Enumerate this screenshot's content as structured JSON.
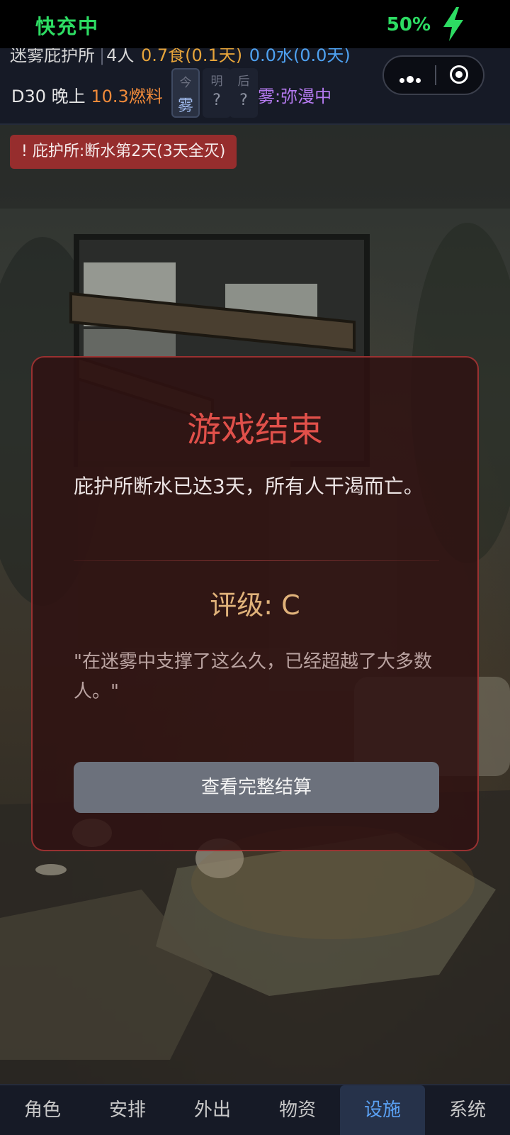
{
  "status_bar": {
    "left_text": "快充中",
    "battery": "50%"
  },
  "header": {
    "resource_row": {
      "shelter": "迷雾庇护所",
      "people": "4人",
      "food": "0.7食(0.1天)",
      "water": "0.0水(0.0天)"
    },
    "day": "D30",
    "period": "晚上",
    "fuel": "10.3燃料",
    "forecast": [
      {
        "label": "今",
        "value": "雾"
      },
      {
        "label": "明",
        "value": "?"
      },
      {
        "label": "后",
        "value": "?"
      }
    ],
    "fog_status": "雾:弥漫中"
  },
  "alert": {
    "text": "! 庇护所:断水第2天(3天全灭)"
  },
  "modal": {
    "title": "游戏结束",
    "message": "庇护所断水已达3天，所有人干渴而亡。",
    "rating": "评级: C",
    "quote": "\"在迷雾中支撑了这么久，已经超越了大多数人。\"",
    "button": "查看完整结算"
  },
  "bottom_nav": {
    "items": [
      "角色",
      "安排",
      "外出",
      "物资",
      "设施",
      "系统"
    ],
    "active": "设施"
  },
  "colors": {
    "accent_red": "#e0504a",
    "rating_gold": "#e0b27a",
    "nav_active": "#5aa0f2",
    "fog_purple": "#b57af0"
  }
}
